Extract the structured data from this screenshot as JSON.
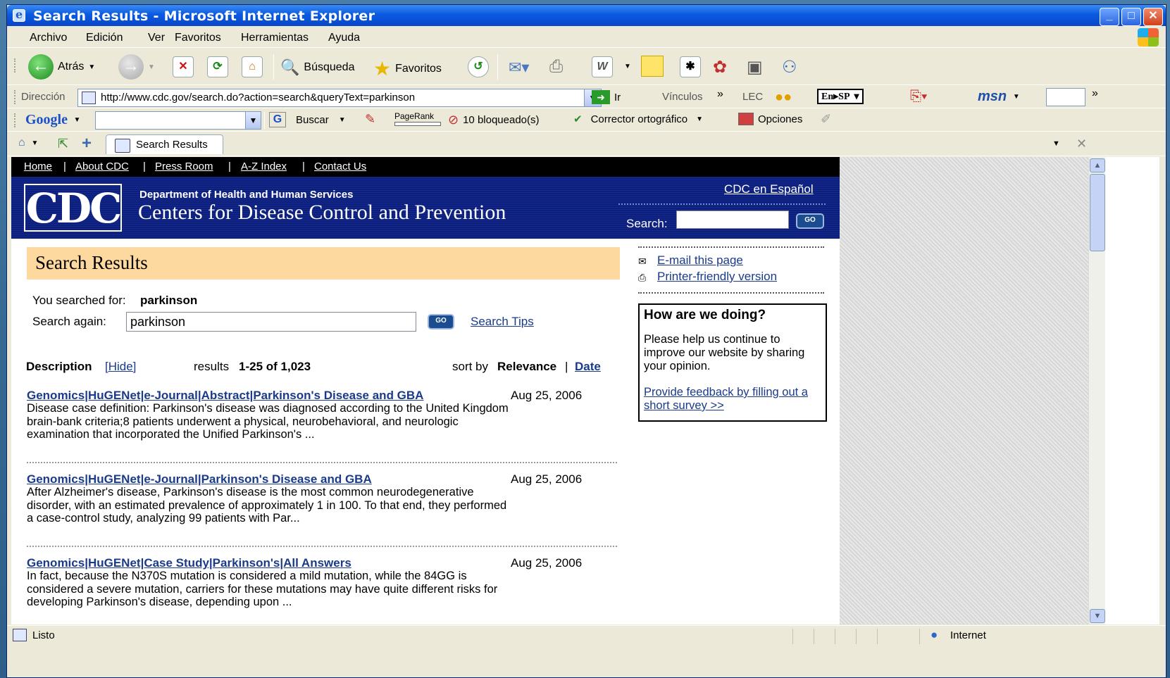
{
  "window": {
    "title": "Search Results - Microsoft Internet Explorer"
  },
  "menu": [
    "Archivo",
    "Edición",
    "Ver",
    "Favoritos",
    "Herramientas",
    "Ayuda"
  ],
  "toolbar": {
    "back": "Atrás",
    "search": "Búsqueda",
    "favorites": "Favoritos"
  },
  "address": {
    "label": "Dirección",
    "url": "http://www.cdc.gov/search.do?action=search&queryText=parkinson",
    "go": "Ir",
    "links": "Vínculos",
    "lec": "LEC",
    "lang": "En▸SP",
    "msn": "msn"
  },
  "google": {
    "logo": "Google",
    "search": "Buscar",
    "pagerank": "PageRank",
    "blocked": "10 bloqueado(s)",
    "spell": "Corrector ortográfico",
    "options": "Opciones"
  },
  "tabs": {
    "active": "Search Results"
  },
  "cdc": {
    "nav": [
      "Home",
      "About CDC",
      "Press Room",
      "A-Z Index",
      "Contact Us"
    ],
    "logo": "CDC",
    "dept": "Department of Health and Human Services",
    "name": "Centers for Disease Control and Prevention",
    "spanish": "CDC en Español",
    "search_label": "Search:",
    "go": "GO"
  },
  "results_page": {
    "heading": "Search Results",
    "searched_for_label": "You searched for:",
    "query": "parkinson",
    "search_again_label": "Search again:",
    "search_tips": "Search Tips",
    "description_label": "Description",
    "hide": "[Hide]",
    "results_prefix": "results",
    "results_range": "1-25 of 1,023",
    "sort_by": "sort by",
    "sort_relevance": "Relevance",
    "sort_sep": "|",
    "sort_date": "Date"
  },
  "results": [
    {
      "title": "Genomics|HuGENet|e-Journal|Abstract|Parkinson's Disease and GBA",
      "date": "Aug 25, 2006",
      "desc": "Disease case definition: Parkinson's disease was diagnosed according to the United Kingdom brain-bank criteria;8 patients underwent a physical, neurobehavioral, and neurologic examination that incorporated the Unified Parkinson's ..."
    },
    {
      "title": "Genomics|HuGENet|e-Journal|Parkinson's Disease and GBA",
      "date": "Aug 25, 2006",
      "desc": "After Alzheimer's disease, Parkinson's disease is the most common neurodegenerative disorder, with an estimated prevalence of approximately 1 in 100. To that end, they performed a case-control study, analyzing 99 patients with Par..."
    },
    {
      "title": "Genomics|HuGENet|Case Study|Parkinson's|All Answers",
      "date": "Aug 25, 2006",
      "desc": "In fact, because the N370S mutation is considered a mild mutation, while the 84GG is considered a    severe    mutation, carriers for these mutations may have quite different risks for developing Parkinson's disease, depending upon ..."
    }
  ],
  "sidebar": {
    "email": "E-mail this page",
    "printer": "Printer-friendly version",
    "box_title": "How are we doing?",
    "box_text": "Please help us continue to improve our website by sharing your opinion.",
    "box_link": "Provide feedback by filling out a short survey >>"
  },
  "status": {
    "text": "Listo",
    "zone": "Internet"
  }
}
